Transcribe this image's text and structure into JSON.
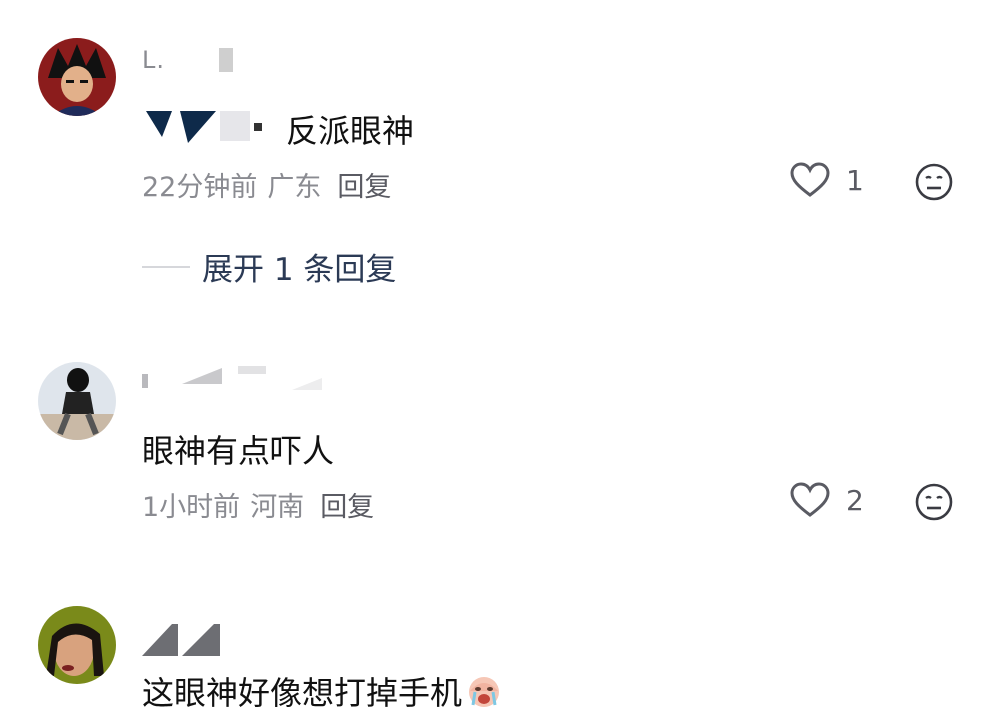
{
  "comments": [
    {
      "username": "L.",
      "text": "反派眼神",
      "time": "22分钟前",
      "location": "广东",
      "reply_label": "回复",
      "likes": "1",
      "expand_replies": "展开 1 条回复"
    },
    {
      "username": "",
      "text": "眼神有点吓人",
      "time": "1小时前",
      "location": "河南",
      "reply_label": "回复",
      "likes": "2"
    },
    {
      "username": "",
      "text": "这眼神好像想打掉手机"
    }
  ],
  "icons": {
    "like": "heart-outline-icon",
    "dislike": "meh-face-icon",
    "emoji": "crying-face-emoji"
  }
}
